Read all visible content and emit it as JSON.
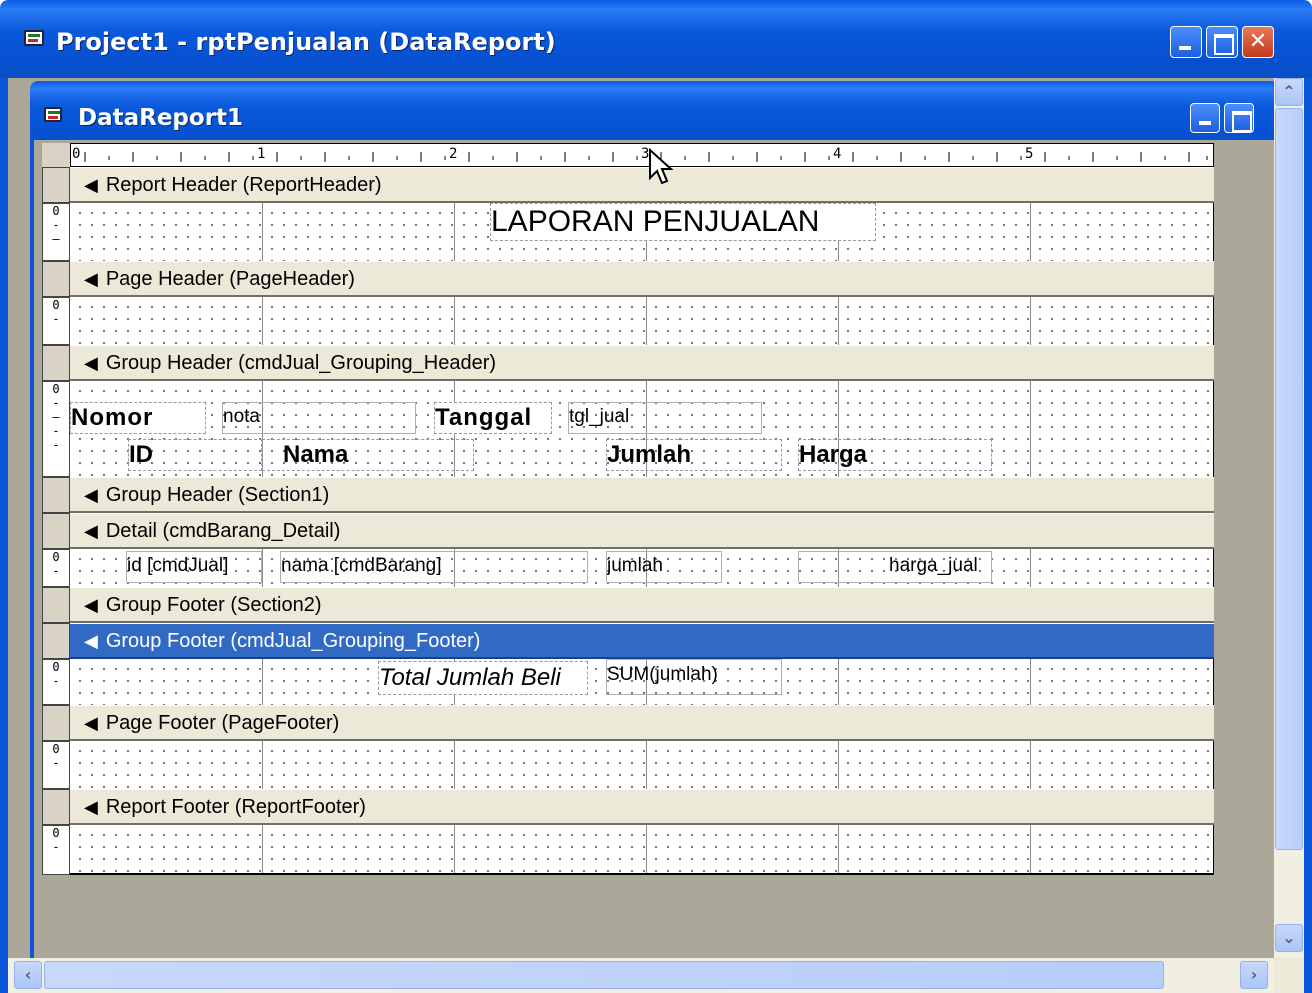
{
  "window": {
    "title": "Project1 - rptPenjualan (DataReport)"
  },
  "child_window": {
    "title": "DataReport1"
  },
  "ruler": {
    "marks": [
      "0",
      "1",
      "2",
      "3",
      "4",
      "5"
    ]
  },
  "vruler": {
    "zero": "0"
  },
  "bands": {
    "report_header": "Report Header (ReportHeader)",
    "page_header": "Page Header (PageHeader)",
    "group_header_jual": "Group Header (cmdJual_Grouping_Header)",
    "group_header_section1": "Group Header (Section1)",
    "detail": "Detail (cmdBarang_Detail)",
    "group_footer_section2": "Group Footer (Section2)",
    "group_footer_jual": "Group Footer (cmdJual_Grouping_Footer)",
    "page_footer": "Page Footer (PageFooter)",
    "report_footer": "Report Footer (ReportFooter)"
  },
  "controls": {
    "title_label": "LAPORAN PENJUALAN",
    "nomor_label": "Nomor",
    "nota_field": "nota",
    "tanggal_label": "Tanggal",
    "tgl_jual_field": "tgl_jual",
    "id_label": "ID",
    "nama_label": "Nama",
    "jumlah_label": "Jumlah",
    "harga_label": "Harga",
    "id_field": "id [cmdJual]",
    "nama_field": "nama [cmdBarang]",
    "jumlah_field": "jumlah",
    "harga_jual_field": "harga_jual",
    "total_label": "Total Jumlah Beli",
    "sum_field": "SUM(jumlah)"
  },
  "colors": {
    "title_bar": "#0a59dc",
    "selected_band": "#316ac5",
    "band": "#ece9d8",
    "workspace": "#aca899"
  },
  "icons": [
    "app-icon",
    "minimize-icon",
    "maximize-icon",
    "close-icon",
    "band-arrow-icon",
    "mouse-cursor-icon",
    "scroll-up-icon",
    "scroll-down-icon",
    "scroll-left-icon",
    "scroll-right-icon",
    "size-grip-icon"
  ]
}
